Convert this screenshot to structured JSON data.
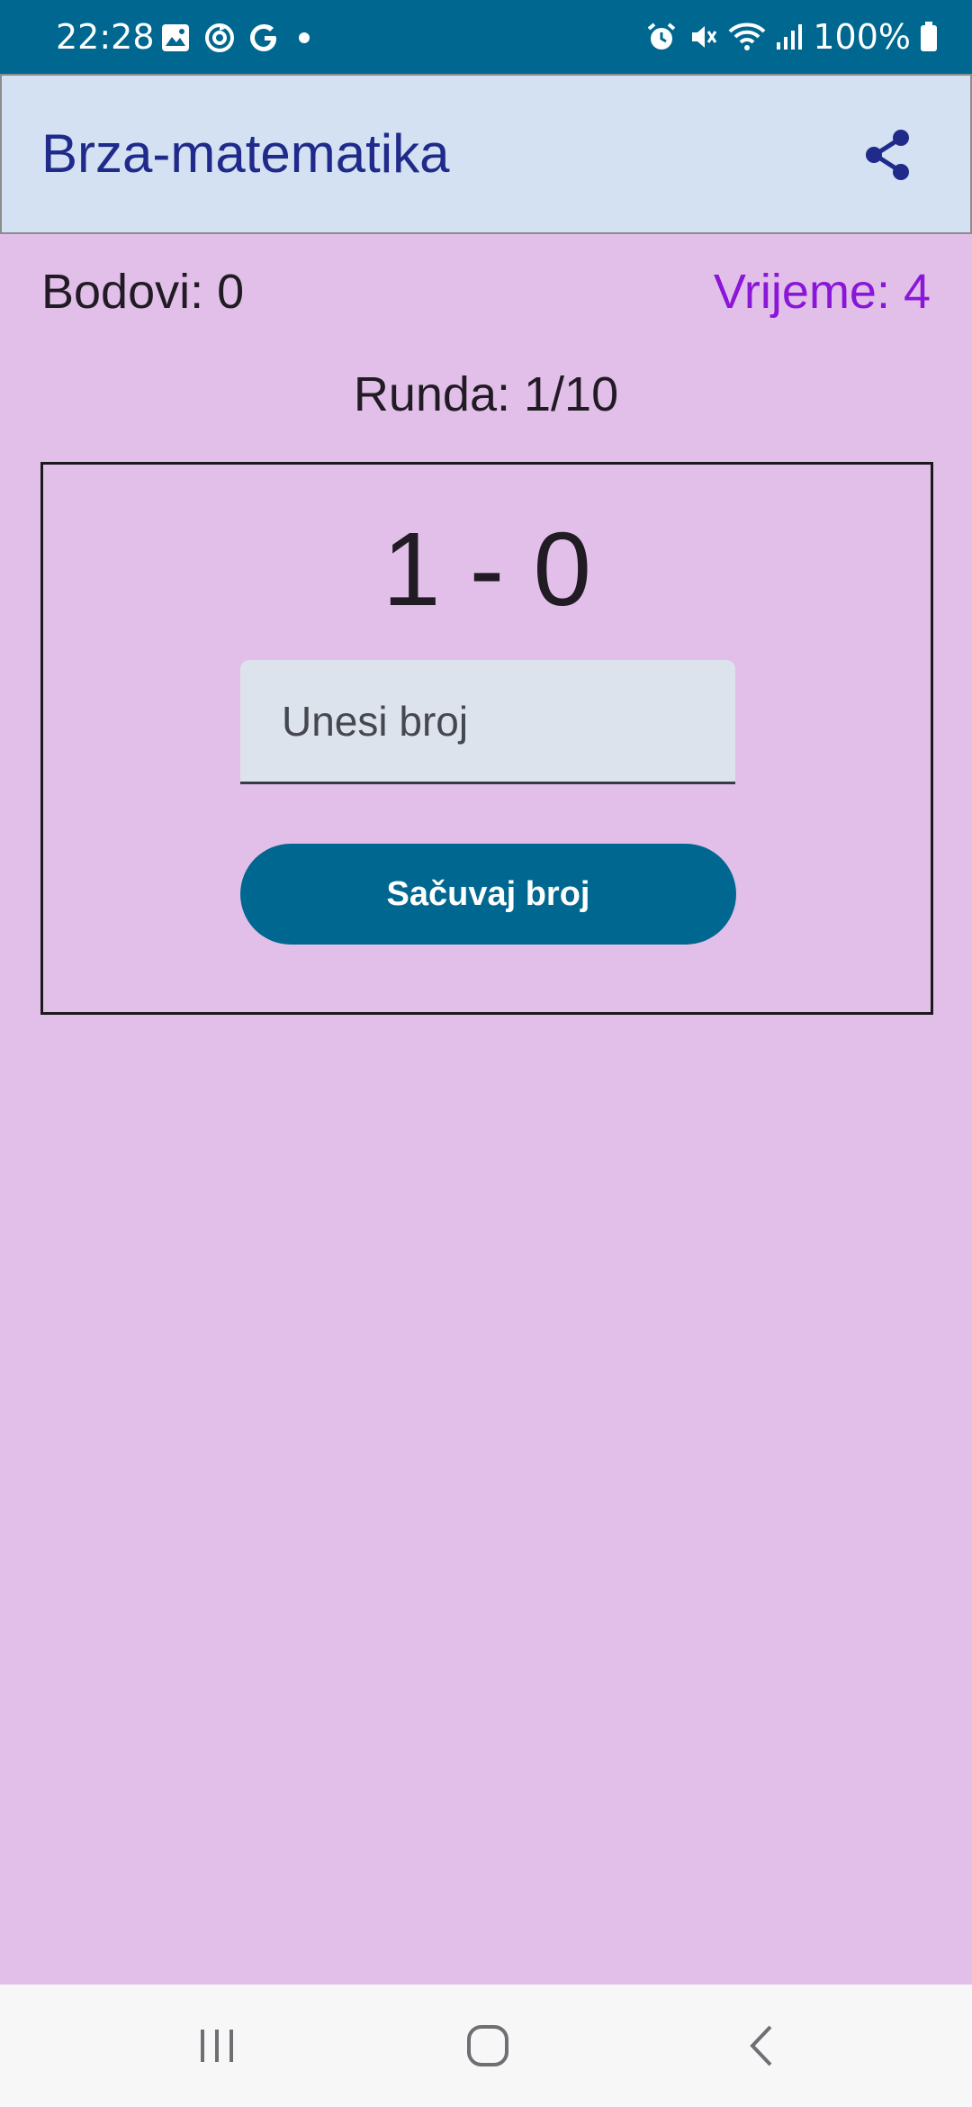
{
  "status_bar": {
    "time": "22:28",
    "battery": "100%",
    "left_icons": [
      "gallery-icon",
      "sync-icon",
      "google-icon",
      "notification-dot-icon"
    ],
    "right_icons": [
      "alarm-icon",
      "mute-icon",
      "wifi-icon",
      "signal-icon",
      "battery-icon"
    ]
  },
  "app_bar": {
    "title": "Brza-matematika",
    "share_icon": "share-icon"
  },
  "game": {
    "score": "Bodovi: 0",
    "time": "Vrijeme: 4",
    "round": "Runda: 1/10",
    "problem": "1 - 0",
    "input": {
      "placeholder": "Unesi broj",
      "value": ""
    },
    "save_label": "Sačuvaj broj"
  },
  "nav_bar": {
    "buttons": [
      "recent-apps-icon",
      "home-icon",
      "back-icon"
    ]
  },
  "colors": {
    "status_bar": "#006890",
    "app_bar": "#d3e1f2",
    "background": "#e2bfe9",
    "title": "#1f2a8a",
    "time_accent": "#8a16d8",
    "button": "#006890",
    "input_bg": "#dce3ec"
  }
}
